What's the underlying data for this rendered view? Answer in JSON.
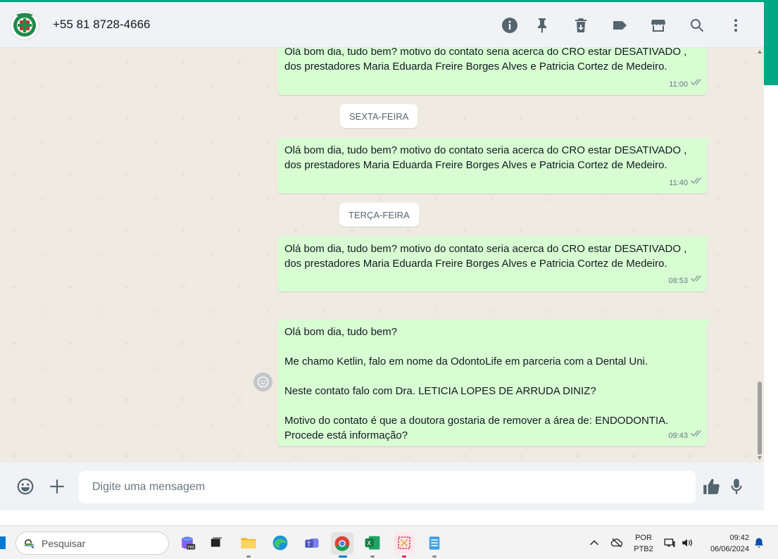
{
  "header": {
    "contact": "+55 81 8728-4666",
    "icons": [
      "info-icon",
      "pin-icon",
      "delete-icon",
      "label-icon",
      "catalog-icon",
      "search-icon",
      "menu-icon"
    ]
  },
  "messages": [
    {
      "text": "Olá bom dia, tudo bem? motivo do contato seria acerca do CRO estar DESATIVADO ,\ndos prestadores Maria Eduarda Freire Borges Alves e Patricia Cortez de Medeiro.",
      "time": "11:00",
      "status": "read"
    },
    {
      "date_chip": "SEXTA-FEIRA"
    },
    {
      "text": "Olá bom dia, tudo bem? motivo do contato seria acerca do CRO estar DESATIVADO ,\ndos prestadores Maria Eduarda Freire Borges Alves e Patricia Cortez de Medeiro.",
      "time": "11:40",
      "status": "read"
    },
    {
      "date_chip": "TERÇA-FEIRA"
    },
    {
      "text": "Olá bom dia, tudo bem? motivo do contato seria acerca do CRO estar DESATIVADO ,\ndos prestadores Maria Eduarda Freire Borges Alves e Patricia Cortez de Medeiro.",
      "time": "08:53",
      "status": "read"
    },
    {
      "text": "Olá bom dia, tudo bem?\n\nMe chamo Ketlin, falo em nome da OdontoLife em parceria com a Dental Uni.\n\nNeste contato falo com Dra. LETICIA LOPES DE ARRUDA DINIZ?\n\nMotivo do contato é que a doutora gostaria de remover a área de: ENDODONTIA.\nProcede está informação?",
      "time": "09:43",
      "status": "read"
    }
  ],
  "composer": {
    "placeholder": "Digite uma mensagem",
    "left_icons": [
      "emoji-icon",
      "attach-plus-icon"
    ],
    "right_icons": [
      "thumbs-up-icon",
      "microphone-icon"
    ]
  },
  "taskbar": {
    "search_placeholder": "Pesquisar",
    "apps": [
      "copilot",
      "task-view",
      "file-explorer",
      "edge",
      "teams",
      "chrome",
      "excel",
      "snipping-tool",
      "notepad"
    ],
    "language_line1": "POR",
    "language_line2": "PTB2",
    "time": "09:42",
    "date": "06/06/2024"
  },
  "colors": {
    "accent": "#00a884",
    "outgoing_bubble": "#d9fdd3",
    "chat_background": "#efeae2",
    "header_background": "#f0f2f5"
  }
}
